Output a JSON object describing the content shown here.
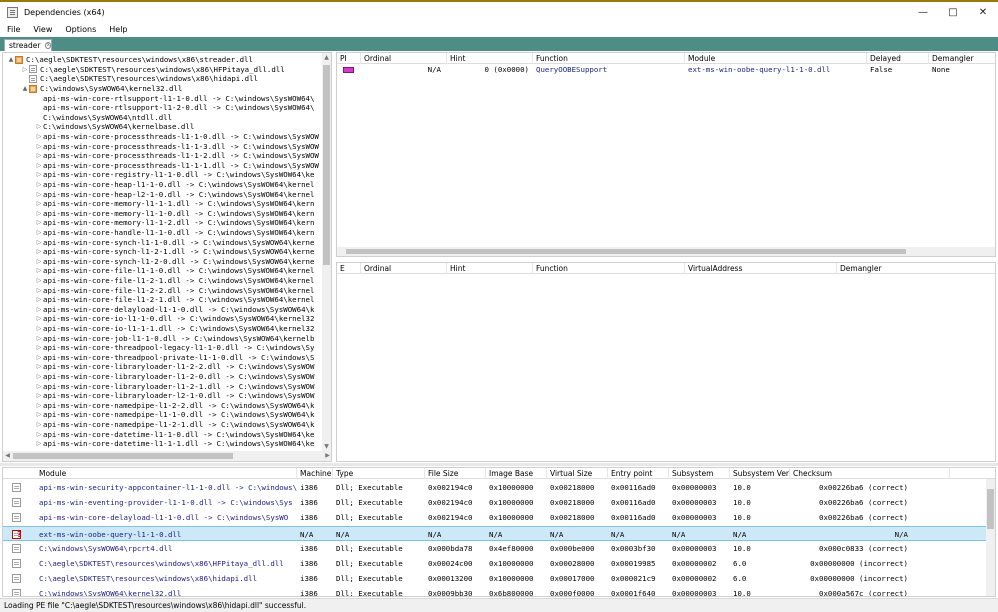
{
  "window": {
    "title": "Dependencies (x64)",
    "icon": "app-window-icon",
    "controls": [
      "minimize-icon",
      "maximize-icon",
      "close-icon"
    ]
  },
  "menu": [
    "File",
    "View",
    "Options",
    "Help"
  ],
  "tab": {
    "label": "streader",
    "close": "x"
  },
  "tree": {
    "rows": [
      {
        "text": "C:\\aegle\\SDKTEST\\resources\\windows\\x86\\streader.dll",
        "level": 0,
        "twisty": "▲",
        "icon": "orange"
      },
      {
        "text": "C:\\aegle\\SDKTEST\\resources\\windows\\x86\\HFPitaya_dll.dll",
        "level": 1,
        "twisty": "▷",
        "icon": "plain"
      },
      {
        "text": "C:\\aegle\\SDKTEST\\resources\\windows\\x86\\hidapi.dll",
        "level": 1,
        "twisty": "",
        "icon": "plain"
      },
      {
        "text": "C:\\windows\\SysWOW64\\kernel32.dll",
        "level": 1,
        "twisty": "▲",
        "icon": "orange"
      },
      {
        "text": "api-ms-win-core-rtlsupport-l1-1-0.dll -> C:\\windows\\SysWOW64\\",
        "level": 2,
        "twisty": "",
        "icon": "none"
      },
      {
        "text": "api-ms-win-core-rtlsupport-l1-2-0.dll -> C:\\windows\\SysWOW64\\",
        "level": 2,
        "twisty": "",
        "icon": "none"
      },
      {
        "text": "C:\\windows\\SysWOW64\\ntdll.dll",
        "level": 2,
        "twisty": "",
        "icon": "none"
      },
      {
        "text": "C:\\windows\\SysWOW64\\kernelbase.dll",
        "level": 2,
        "twisty": "▷",
        "icon": "none"
      },
      {
        "text": "api-ms-win-core-processthreads-l1-1-0.dll -> C:\\windows\\SysWOW",
        "level": 2,
        "twisty": "▷",
        "icon": "none"
      },
      {
        "text": "api-ms-win-core-processthreads-l1-1-3.dll -> C:\\windows\\SysWOW",
        "level": 2,
        "twisty": "▷",
        "icon": "none"
      },
      {
        "text": "api-ms-win-core-processthreads-l1-1-2.dll -> C:\\windows\\SysWOW",
        "level": 2,
        "twisty": "▷",
        "icon": "none"
      },
      {
        "text": "api-ms-win-core-processthreads-l1-1-1.dll -> C:\\windows\\SysWOW",
        "level": 2,
        "twisty": "▷",
        "icon": "none"
      },
      {
        "text": "api-ms-win-core-registry-l1-1-0.dll -> C:\\windows\\SysWOW64\\ke",
        "level": 2,
        "twisty": "▷",
        "icon": "none"
      },
      {
        "text": "api-ms-win-core-heap-l1-1-0.dll -> C:\\windows\\SysWOW64\\kernel",
        "level": 2,
        "twisty": "▷",
        "icon": "none"
      },
      {
        "text": "api-ms-win-core-heap-l2-1-0.dll -> C:\\windows\\SysWOW64\\kernel",
        "level": 2,
        "twisty": "▷",
        "icon": "none"
      },
      {
        "text": "api-ms-win-core-memory-l1-1-1.dll -> C:\\windows\\SysWOW64\\kern",
        "level": 2,
        "twisty": "▷",
        "icon": "none"
      },
      {
        "text": "api-ms-win-core-memory-l1-1-0.dll -> C:\\windows\\SysWOW64\\kern",
        "level": 2,
        "twisty": "▷",
        "icon": "none"
      },
      {
        "text": "api-ms-win-core-memory-l1-1-2.dll -> C:\\windows\\SysWOW64\\kern",
        "level": 2,
        "twisty": "▷",
        "icon": "none"
      },
      {
        "text": "api-ms-win-core-handle-l1-1-0.dll -> C:\\windows\\SysWOW64\\kern",
        "level": 2,
        "twisty": "▷",
        "icon": "none"
      },
      {
        "text": "api-ms-win-core-synch-l1-1-0.dll -> C:\\windows\\SysWOW64\\kerne",
        "level": 2,
        "twisty": "▷",
        "icon": "none"
      },
      {
        "text": "api-ms-win-core-synch-l1-2-1.dll -> C:\\windows\\SysWOW64\\kerne",
        "level": 2,
        "twisty": "▷",
        "icon": "none"
      },
      {
        "text": "api-ms-win-core-synch-l1-2-0.dll -> C:\\windows\\SysWOW64\\kerne",
        "level": 2,
        "twisty": "▷",
        "icon": "none"
      },
      {
        "text": "api-ms-win-core-file-l1-1-0.dll -> C:\\windows\\SysWOW64\\kernel",
        "level": 2,
        "twisty": "▷",
        "icon": "none"
      },
      {
        "text": "api-ms-win-core-file-l1-2-1.dll -> C:\\windows\\SysWOW64\\kernel",
        "level": 2,
        "twisty": "▷",
        "icon": "none"
      },
      {
        "text": "api-ms-win-core-file-l1-2-2.dll -> C:\\windows\\SysWOW64\\kernel",
        "level": 2,
        "twisty": "▷",
        "icon": "none"
      },
      {
        "text": "api-ms-win-core-file-l1-2-1.dll -> C:\\windows\\SysWOW64\\kernel",
        "level": 2,
        "twisty": "▷",
        "icon": "none"
      },
      {
        "text": "api-ms-win-core-delayload-l1-1-0.dll -> C:\\windows\\SysWOW64\\k",
        "level": 2,
        "twisty": "▷",
        "icon": "none"
      },
      {
        "text": "api-ms-win-core-io-l1-1-0.dll -> C:\\windows\\SysWOW64\\kernel32",
        "level": 2,
        "twisty": "▷",
        "icon": "none"
      },
      {
        "text": "api-ms-win-core-io-l1-1-1.dll -> C:\\windows\\SysWOW64\\kernel32",
        "level": 2,
        "twisty": "▷",
        "icon": "none"
      },
      {
        "text": "api-ms-win-core-job-l1-1-0.dll -> C:\\windows\\SysWOW64\\kernelb",
        "level": 2,
        "twisty": "▷",
        "icon": "none"
      },
      {
        "text": "api-ms-win-core-threadpool-legacy-l1-1-0.dll -> C:\\windows\\Sy",
        "level": 2,
        "twisty": "▷",
        "icon": "none"
      },
      {
        "text": "api-ms-win-core-threadpool-private-l1-1-0.dll -> C:\\windows\\S",
        "level": 2,
        "twisty": "▷",
        "icon": "none"
      },
      {
        "text": "api-ms-win-core-libraryloader-l1-2-2.dll -> C:\\windows\\SysWOW",
        "level": 2,
        "twisty": "▷",
        "icon": "none"
      },
      {
        "text": "api-ms-win-core-libraryloader-l1-2-0.dll -> C:\\windows\\SysWOW",
        "level": 2,
        "twisty": "▷",
        "icon": "none"
      },
      {
        "text": "api-ms-win-core-libraryloader-l1-2-1.dll -> C:\\windows\\SysWOW",
        "level": 2,
        "twisty": "▷",
        "icon": "none"
      },
      {
        "text": "api-ms-win-core-libraryloader-l2-1-0.dll -> C:\\windows\\SysWOW",
        "level": 2,
        "twisty": "▷",
        "icon": "none"
      },
      {
        "text": "api-ms-win-core-namedpipe-l1-2-2.dll -> C:\\windows\\SysWOW64\\k",
        "level": 2,
        "twisty": "▷",
        "icon": "none"
      },
      {
        "text": "api-ms-win-core-namedpipe-l1-1-0.dll -> C:\\windows\\SysWOW64\\k",
        "level": 2,
        "twisty": "▷",
        "icon": "none"
      },
      {
        "text": "api-ms-win-core-namedpipe-l1-2-1.dll -> C:\\windows\\SysWOW64\\k",
        "level": 2,
        "twisty": "▷",
        "icon": "none"
      },
      {
        "text": "api-ms-win-core-datetime-l1-1-0.dll -> C:\\windows\\SysWOW64\\ke",
        "level": 2,
        "twisty": "▷",
        "icon": "none"
      },
      {
        "text": "api-ms-win-core-datetime-l1-1-1.dll -> C:\\windows\\SysWOW64\\ke",
        "level": 2,
        "twisty": "▷",
        "icon": "none"
      }
    ]
  },
  "imports": {
    "columns": [
      "PI",
      "Ordinal",
      "Hint",
      "Function",
      "Module",
      "Delayed",
      "Demangler"
    ],
    "rows": [
      {
        "pi": "",
        "ordinal": "N/A",
        "hint": "0 (0x0000)",
        "function": "QueryOOBESupport",
        "module": "ext-ms-win-oobe-query-l1-1-0.dll",
        "delayed": "False",
        "demangler": "None"
      }
    ]
  },
  "exports": {
    "columns": [
      "E",
      "Ordinal",
      "Hint",
      "Function",
      "VirtualAddress",
      "Demangler"
    ]
  },
  "modules": {
    "columns": [
      "Module",
      "Machine",
      "Type",
      "File Size",
      "Image Base",
      "Virtual Size",
      "Entry point",
      "Subsystem",
      "Subsystem Ver.",
      "Checksum"
    ],
    "rows": [
      {
        "icon": "normal",
        "module": "api-ms-win-security-appcontainer-l1-1-0.dll -> C:\\windows\\",
        "machine": "i386",
        "type": "Dll; Executable",
        "file_size": "0x002194c0",
        "image_base": "0x10000000",
        "virtual_size": "0x00218000",
        "entry_point": "0x00116ad0",
        "subsystem": "0x00000003",
        "subsystem_ver": "10.0",
        "checksum": "0x00226ba6 (correct)"
      },
      {
        "icon": "normal",
        "module": "api-ms-win-eventing-provider-l1-1-0.dll -> C:\\windows\\Sys",
        "machine": "i386",
        "type": "Dll; Executable",
        "file_size": "0x002194c0",
        "image_base": "0x10000000",
        "virtual_size": "0x00218000",
        "entry_point": "0x00116ad0",
        "subsystem": "0x00000003",
        "subsystem_ver": "10.0",
        "checksum": "0x00226ba6 (correct)"
      },
      {
        "icon": "normal",
        "module": "api-ms-win-core-delayload-l1-1-0.dll -> C:\\windows\\SysWO",
        "machine": "i386",
        "type": "Dll; Executable",
        "file_size": "0x002194c0",
        "image_base": "0x10000000",
        "virtual_size": "0x00218000",
        "entry_point": "0x00116ad0",
        "subsystem": "0x00000003",
        "subsystem_ver": "10.0",
        "checksum": "0x00226ba6 (correct)"
      },
      {
        "icon": "missing",
        "selected": true,
        "module": "ext-ms-win-oobe-query-l1-1-0.dll",
        "machine": "N/A",
        "type": "N/A",
        "file_size": "N/A",
        "image_base": "N/A",
        "virtual_size": "N/A",
        "entry_point": "N/A",
        "subsystem": "N/A",
        "subsystem_ver": "N/A",
        "checksum": "N/A"
      },
      {
        "icon": "normal",
        "module": "C:\\windows\\SysWOW64\\rpcrt4.dll",
        "machine": "i386",
        "type": "Dll; Executable",
        "file_size": "0x000bda78",
        "image_base": "0x4ef80000",
        "virtual_size": "0x000be000",
        "entry_point": "0x0003bf30",
        "subsystem": "0x00000003",
        "subsystem_ver": "10.0",
        "checksum": "0x000c0833 (correct)"
      },
      {
        "icon": "normal",
        "module": "C:\\aegle\\SDKTEST\\resources\\windows\\x86\\HFPitaya_dll.dll",
        "machine": "i386",
        "type": "Dll; Executable",
        "file_size": "0x00024c00",
        "image_base": "0x10000000",
        "virtual_size": "0x00028000",
        "entry_point": "0x00019985",
        "subsystem": "0x00000002",
        "subsystem_ver": "6.0",
        "checksum": "0x00000000 (incorrect)"
      },
      {
        "icon": "normal",
        "module": "C:\\aegle\\SDKTEST\\resources\\windows\\x86\\hidapi.dll",
        "machine": "i386",
        "type": "Dll; Executable",
        "file_size": "0x00013200",
        "image_base": "0x10000000",
        "virtual_size": "0x00017000",
        "entry_point": "0x000021c9",
        "subsystem": "0x00000002",
        "subsystem_ver": "6.0",
        "checksum": "0x00000000 (incorrect)"
      },
      {
        "icon": "normal",
        "module": "C:\\windows\\SysWOW64\\kernel32.dll",
        "machine": "i386",
        "type": "Dll; Executable",
        "file_size": "0x0009bb30",
        "image_base": "0x6b800000",
        "virtual_size": "0x000f0000",
        "entry_point": "0x0001f640",
        "subsystem": "0x00000003",
        "subsystem_ver": "10.0",
        "checksum": "0x000a567c (correct)"
      }
    ]
  },
  "status": "Loading PE file \"C:\\aegle\\SDKTEST\\resources\\windows\\x86\\hidapi.dll\" successful."
}
